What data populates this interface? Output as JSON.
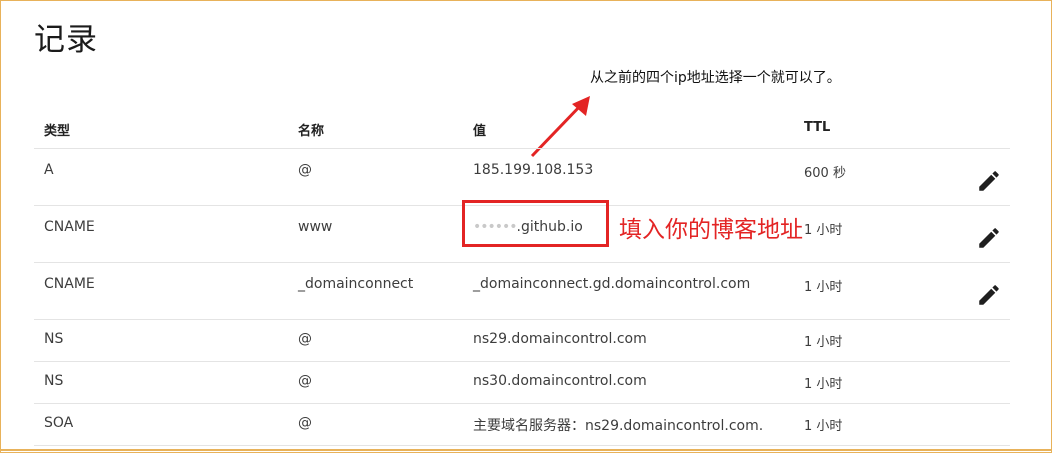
{
  "title": "记录",
  "annotation_note": "从之前的四个ip地址选择一个就可以了。",
  "annotation_callout": "填入你的博客地址",
  "columns": {
    "type": "类型",
    "name": "名称",
    "value": "值",
    "ttl": "TTL"
  },
  "records": [
    {
      "type": "A",
      "name": "@",
      "value": "185.199.108.153",
      "ttl": "600 秒"
    },
    {
      "type": "CNAME",
      "name": "www",
      "value_mask": "••••••",
      "value": ".github.io",
      "ttl": "1 小时"
    },
    {
      "type": "CNAME",
      "name": "_domainconnect",
      "value": "_domainconnect.gd.domaincontrol.com",
      "ttl": "1 小时"
    },
    {
      "type": "NS",
      "name": "@",
      "value": "ns29.domaincontrol.com",
      "ttl": "1 小时"
    },
    {
      "type": "NS",
      "name": "@",
      "value": "ns30.domaincontrol.com",
      "ttl": "1 小时"
    },
    {
      "type": "SOA",
      "name": "@",
      "value": "主要域名服务器：ns29.domaincontrol.com.",
      "ttl": "1 小时"
    }
  ],
  "icons": {
    "edit": "pencil-icon"
  },
  "colors": {
    "annotation_red": "#e32424",
    "frame_border": "#e8b25a"
  }
}
